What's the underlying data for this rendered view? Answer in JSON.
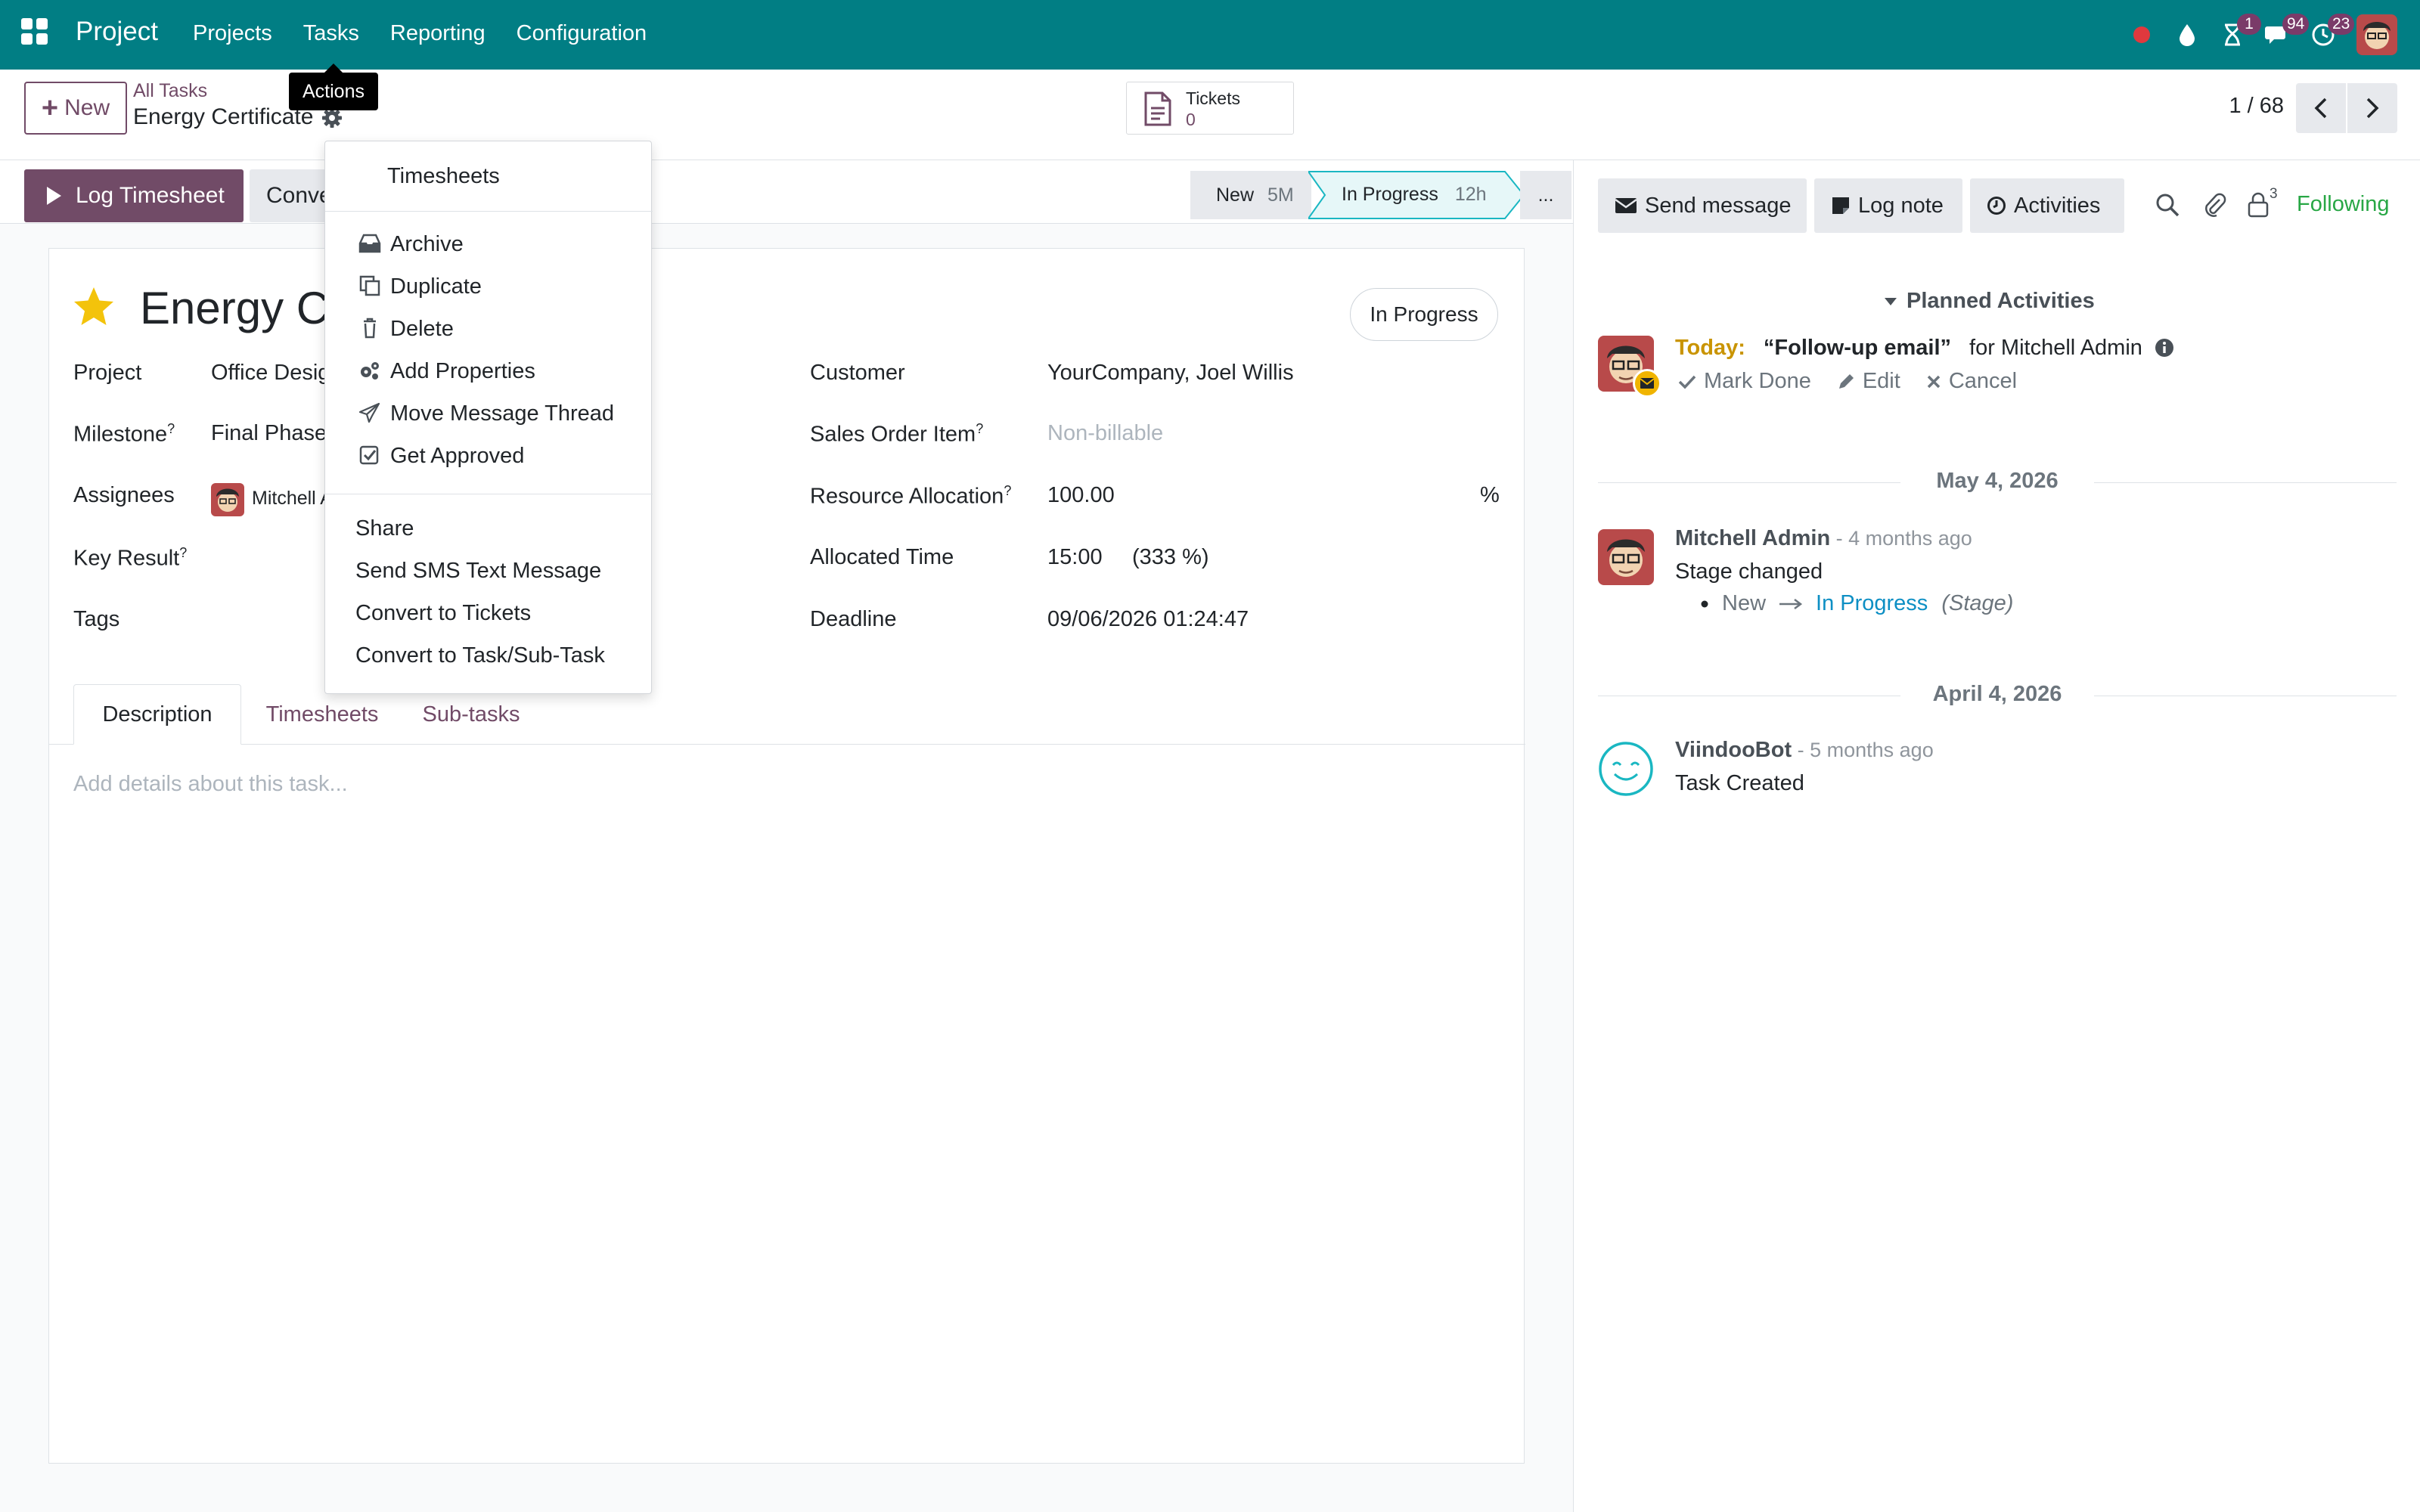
{
  "navbar": {
    "app_title": "Project",
    "menus": [
      "Projects",
      "Tasks",
      "Reporting",
      "Configuration"
    ],
    "badges": {
      "activities": "1",
      "messages": "94",
      "clock": "23"
    },
    "accent": "#017e84"
  },
  "control_panel": {
    "new_label": "New",
    "breadcrumb_parent": "All Tasks",
    "breadcrumb_current": "Energy Certificate",
    "tooltip": "Actions",
    "tickets_label": "Tickets",
    "tickets_count": "0",
    "pager": "1 / 68"
  },
  "statusbar": {
    "log_timesheet": "Log Timesheet",
    "convert_label": "Convert to Ticket",
    "stages": [
      {
        "name": "New",
        "duration": "5M"
      },
      {
        "name": "In Progress",
        "duration": "12h"
      }
    ],
    "more": "..."
  },
  "form": {
    "title": "Energy Certificate",
    "state": "In Progress",
    "labels": {
      "project": "Project",
      "milestone": "Milestone",
      "assignees": "Assignees",
      "key_result": "Key Result",
      "tags": "Tags",
      "customer": "Customer",
      "sales_order_item": "Sales Order Item",
      "resource_allocation": "Resource Allocation",
      "allocated_time": "Allocated Time",
      "deadline": "Deadline",
      "help_mark": "?"
    },
    "values": {
      "project": "Office Design",
      "milestone": "Final Phase",
      "assignee": "Mitchell Admin",
      "customer": "YourCompany, Joel Willis",
      "sales_order_item_placeholder": "Non-billable",
      "resource_allocation": "100.00",
      "resource_allocation_unit": "%",
      "allocated_time": "15:00",
      "allocated_percent": "(333 %)",
      "deadline": "09/06/2026 01:24:47"
    },
    "tabs": [
      "Description",
      "Timesheets",
      "Sub-tasks"
    ],
    "description_placeholder": "Add details about this task..."
  },
  "actions_menu": {
    "top_item": "Timesheets",
    "items_with_icons": [
      {
        "label": "Archive",
        "icon": "inbox-icon"
      },
      {
        "label": "Duplicate",
        "icon": "copy-icon"
      },
      {
        "label": "Delete",
        "icon": "trash-icon"
      },
      {
        "label": "Add Properties",
        "icon": "cogs-icon"
      },
      {
        "label": "Move Message Thread",
        "icon": "paper-plane-icon"
      },
      {
        "label": "Get Approved",
        "icon": "check-square-icon"
      }
    ],
    "plain_items": [
      "Share",
      "Send SMS Text Message",
      "Convert to Tickets",
      "Convert to Task/Sub-Task"
    ]
  },
  "chatter": {
    "send_message": "Send message",
    "log_note": "Log note",
    "activities": "Activities",
    "followers_count": "3",
    "following": "Following",
    "planned_header": "Planned Activities",
    "activity": {
      "today": "Today:",
      "summary": "“Follow-up email”",
      "for_text": "for Mitchell Admin",
      "mark_done": "Mark Done",
      "edit": "Edit",
      "cancel": "Cancel"
    },
    "date_1": "May 4, 2026",
    "message_1": {
      "author": "Mitchell Admin",
      "time": " - 4 months ago",
      "body": "Stage changed",
      "old_value": "New",
      "new_value": "In Progress",
      "field": "(Stage)"
    },
    "date_2": "April 4, 2026",
    "message_2": {
      "author": "ViindooBot",
      "time": " - 5 months ago",
      "body": "Task Created"
    }
  }
}
